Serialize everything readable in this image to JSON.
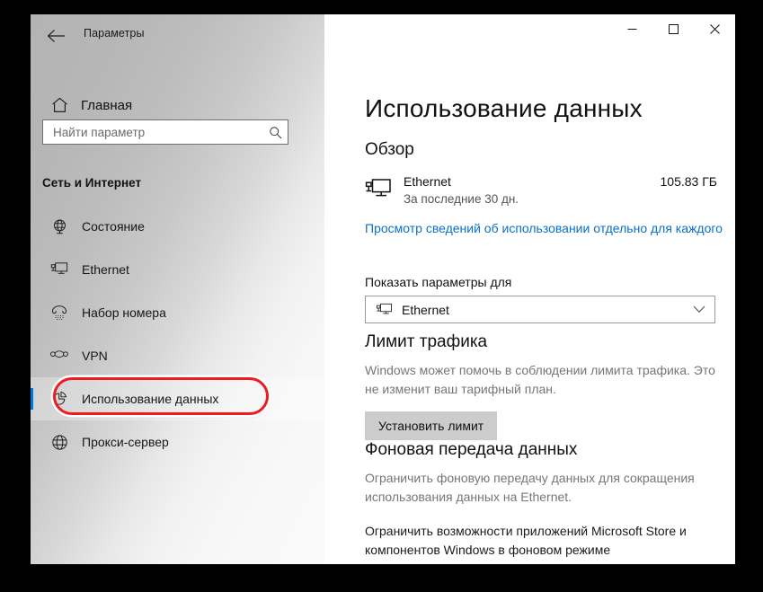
{
  "window": {
    "titlebar_text": "Параметры",
    "back_icon": "back-arrow-icon",
    "controls": {
      "minimize": "—",
      "maximize": "▢",
      "close": "✕"
    }
  },
  "sidebar": {
    "home": {
      "label": "Главная",
      "icon": "home-icon"
    },
    "search": {
      "placeholder": "Найти параметр",
      "value": "",
      "icon": "search-icon"
    },
    "group_heading": "Сеть и Интернет",
    "items": [
      {
        "label": "Состояние",
        "icon": "globe-status-icon",
        "selected": false
      },
      {
        "label": "Ethernet",
        "icon": "ethernet-icon",
        "selected": false
      },
      {
        "label": "Набор номера",
        "icon": "dialup-phone-icon",
        "selected": false
      },
      {
        "label": "VPN",
        "icon": "vpn-icon",
        "selected": false
      },
      {
        "label": "Использование данных",
        "icon": "pie-chart-icon",
        "selected": true
      },
      {
        "label": "Прокси-сервер",
        "icon": "globe-proxy-icon",
        "selected": false
      }
    ],
    "accent_color": "#0078d7",
    "highlight_color": "#ee1c22"
  },
  "main": {
    "page_title": "Использование данных",
    "overview": {
      "heading": "Обзор",
      "adapter_icon": "ethernet-monitor-icon",
      "adapter_name": "Ethernet",
      "period": "За последние 30 дн.",
      "amount": "105.83 ГБ",
      "detail_link": "Просмотр сведений об использовании отдельно для каждого",
      "link_color": "#0a70c8"
    },
    "selector": {
      "label": "Показать параметры для",
      "value": "Ethernet",
      "icon": "ethernet-monitor-icon",
      "chevron": "chevron-down-icon"
    },
    "traffic_limit": {
      "heading": "Лимит трафика",
      "description": "Windows может помочь в соблюдении лимита трафика. Это не изменит ваш тарифный план.",
      "button_label": "Установить лимит"
    },
    "background_data": {
      "heading": "Фоновая передача данных",
      "description": "Ограничить фоновую передачу данных для сокращения использования данных на Ethernet.",
      "note": "Ограничить возможности приложений Microsoft Store и компонентов Windows в фоновом режиме"
    }
  },
  "annotation": {
    "arrow_color": "#d40000",
    "arrow_target": "set-limit-button"
  }
}
